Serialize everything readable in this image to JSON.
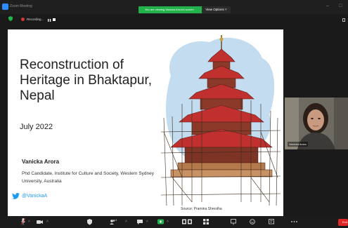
{
  "window": {
    "title": "Zoom Meeting",
    "controls": {
      "minimize": "–",
      "maximize": "□"
    }
  },
  "share_banner": {
    "text": "You are viewing Vanicka Arora's screen",
    "view_options_label": "View Options ˅"
  },
  "recording": {
    "label": "Recording..."
  },
  "slide": {
    "title": "Reconstruction of Heritage in Bhaktapur, Nepal",
    "date": "July 2022",
    "presenter_name": "Vanicka Arora",
    "presenter_affiliation": "Phd Candidate, Institute for Culture and Society, Western Sydney University, Australia",
    "twitter_handle": "@VanickaA",
    "image_source": "Source: Pramina Shrestha"
  },
  "video": {
    "participant_name": "Vanicka Arora"
  },
  "toolbar": {
    "participants_count": "4",
    "end_label": "End"
  },
  "colors": {
    "zoom_blue": "#2d8cff",
    "banner_green": "#21b24b",
    "twitter_blue": "#1d9bf0",
    "end_red": "#e02828",
    "pagoda_red": "#c0302f"
  }
}
